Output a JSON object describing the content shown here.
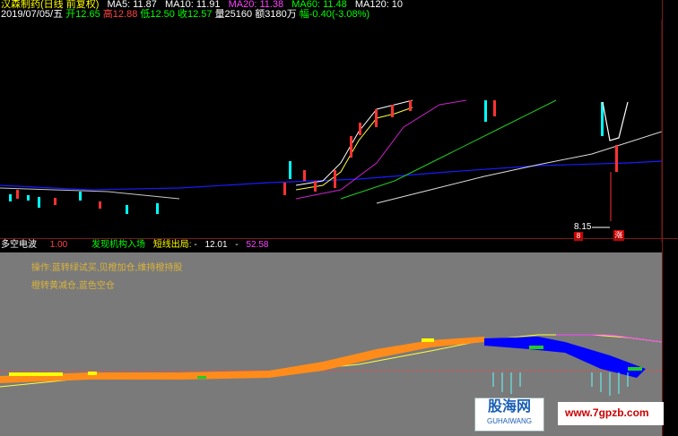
{
  "header": {
    "stock_name": "汉森制药(日线 前复权)",
    "ma5": "MA5: 11.87",
    "ma10": "MA10: 11.91",
    "ma20": "MA20: 11.38",
    "ma60": "MA60: 11.48",
    "ma120": "MA120: 10"
  },
  "info": {
    "date": "2019/07/05/五",
    "open": "开12.65",
    "high": "高12.88",
    "low": "低12.50",
    "close": "收12.57",
    "volume": "量25160",
    "amount": "额3180万",
    "change": "幅-0.40(-3.08%)"
  },
  "price_labels": {
    "low_marker": "8.15",
    "up_badge": "涨",
    "down_badge": "8"
  },
  "indicator": {
    "name": "多空电波",
    "value1": "1.00",
    "label2": "发现机构入场",
    "label3": "短线出局:",
    "sep": "-",
    "value3": "12.01",
    "sep2": "-",
    "value4": "52.58"
  },
  "notes": {
    "line1": "操作:蓝转绿试买,见橙加仓,维持橙持股",
    "line2": "橙转黄减仓,蓝色空仓"
  },
  "watermark": {
    "logo_text": "股海网",
    "logo_sub": "GUHAIWANG",
    "site": "www.7gpzb.com"
  },
  "colors": {
    "ma5": "#ffffff",
    "ma10": "#ffff00",
    "ma20": "#ff00ff",
    "ma60": "#00ff00",
    "ma120": "#ffffff",
    "up": "#ff3232",
    "down": "#00ffff",
    "orange": "#ff8c1a",
    "blue": "#0000ff"
  }
}
